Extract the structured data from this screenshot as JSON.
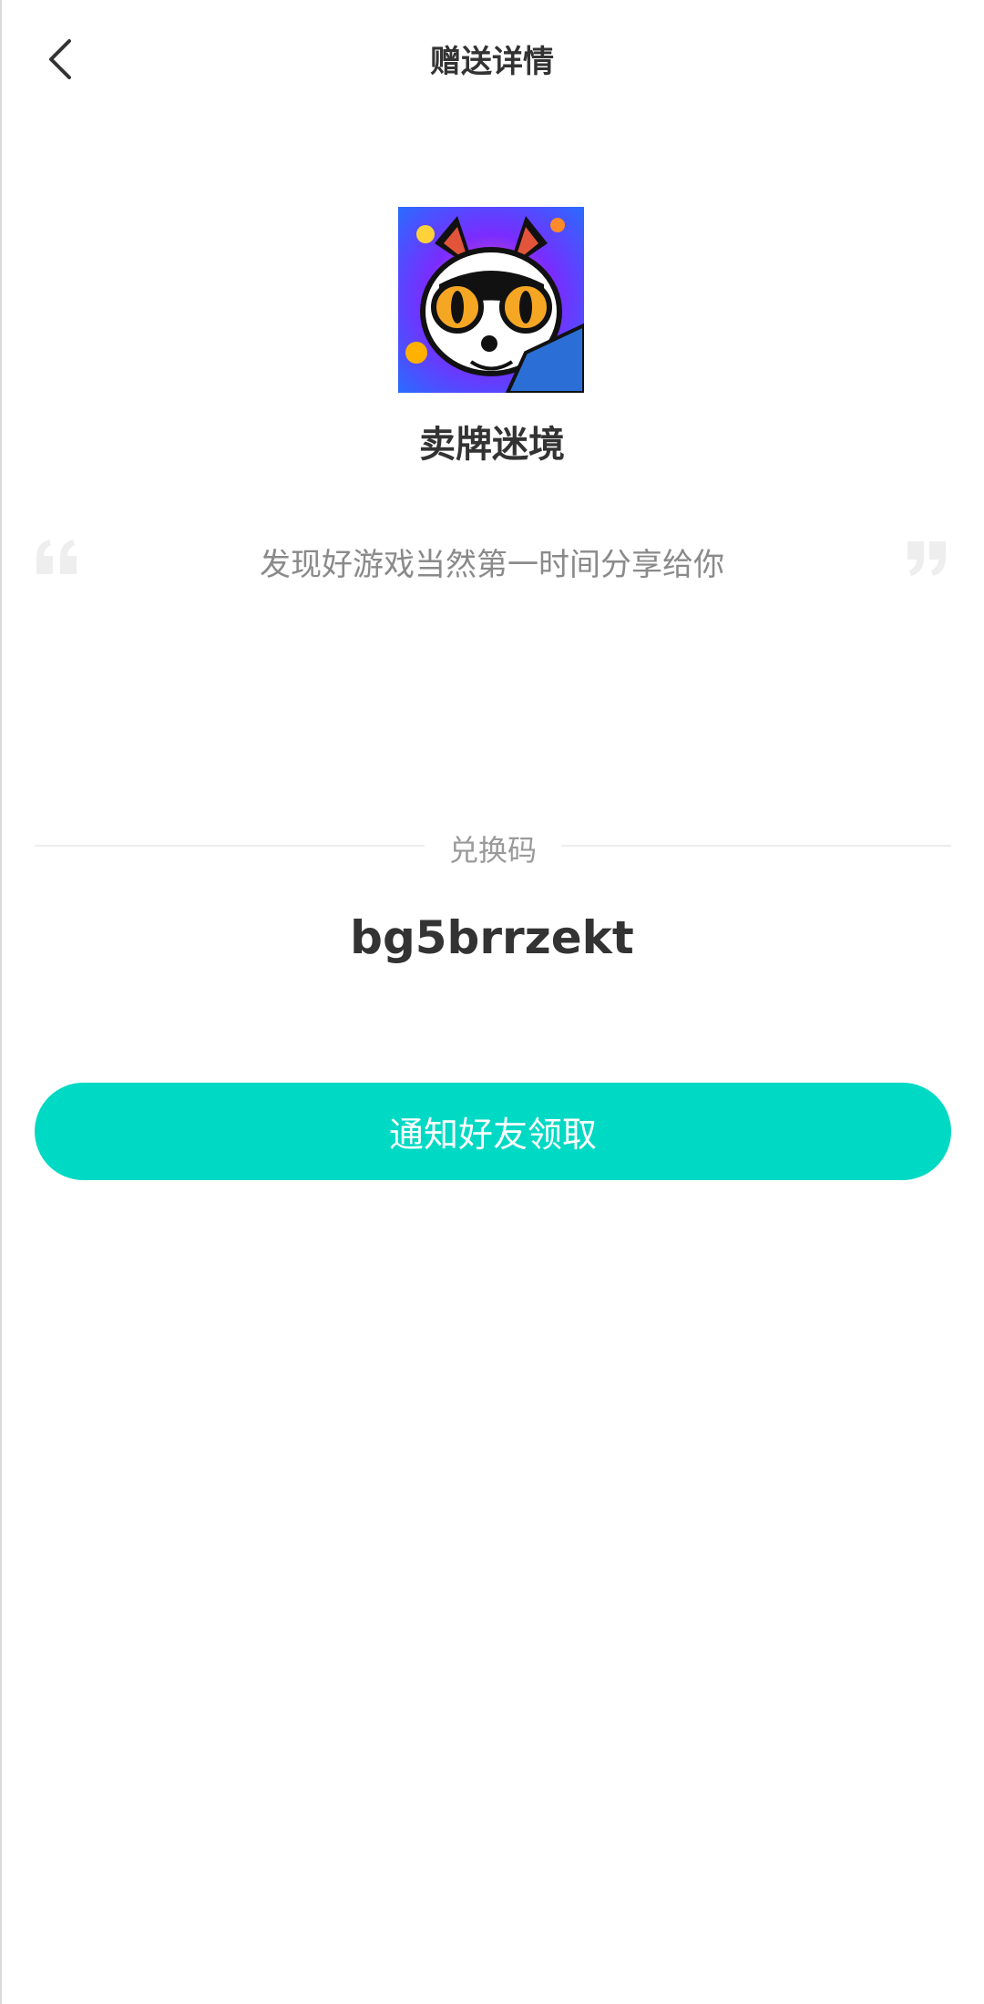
{
  "header": {
    "title": "赠送详情"
  },
  "gift": {
    "game_name": "卖牌迷境",
    "message": "发现好游戏当然第一时间分享给你",
    "code_label": "兑换码",
    "code_value": "bg5brrzekt"
  },
  "actions": {
    "notify_label": "通知好友领取"
  },
  "colors": {
    "accent": "#00d9c4",
    "title_text": "#333333",
    "muted_text": "#8a8a8a",
    "divider": "#ededed"
  },
  "icons": {
    "back": "chevron-left-icon",
    "quote_open": "open-quote-icon",
    "quote_close": "close-quote-icon"
  }
}
